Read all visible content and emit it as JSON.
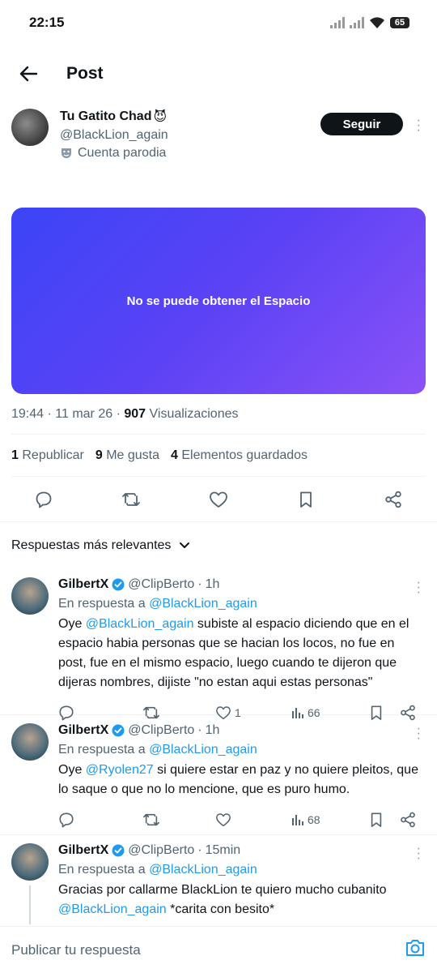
{
  "status_bar": {
    "time": "22:15",
    "battery": "65"
  },
  "header": {
    "title": "Post"
  },
  "author": {
    "name": "Tu Gatito Chad",
    "emoji": "😈",
    "handle": "@BlackLion_again",
    "badge_label": "Cuenta parodia",
    "follow_label": "Seguir"
  },
  "space_card": {
    "message": "No se puede obtener el Espacio"
  },
  "meta": {
    "time": "19:44",
    "date": "11 mar 26",
    "views_count": "907",
    "views_label": "Visualizaciones"
  },
  "stats": {
    "reposts_count": "1",
    "reposts_label": "Republicar",
    "likes_count": "9",
    "likes_label": "Me gusta",
    "bookmarks_count": "4",
    "bookmarks_label": "Elementos guardados"
  },
  "sort": {
    "label": "Respuestas más relevantes"
  },
  "replies": [
    {
      "name": "GilbertX",
      "handle": "@ClipBerto",
      "time": "1h",
      "replying_prefix": "En respuesta a",
      "replying_to": "@BlackLion_again",
      "text_prefix": "Oye",
      "mention": "@BlackLion_again",
      "text_rest": "subiste al espacio diciendo que en el espacio habia personas que se hacian los locos, no fue en post, fue en el mismo espacio, luego cuando te dijeron que dijeras nombres, dijiste \"no estan aqui estas personas\"",
      "likes": "1",
      "views": "66"
    },
    {
      "name": "GilbertX",
      "handle": "@ClipBerto",
      "time": "1h",
      "replying_prefix": "En respuesta a",
      "replying_to": "@BlackLion_again",
      "text_prefix": "Oye",
      "mention": "@Ryolen27",
      "text_rest": "si quiere estar en paz y no quiere pleitos, que lo saque o que no lo mencione, que es puro humo.",
      "likes": "",
      "views": "68"
    },
    {
      "name": "GilbertX",
      "handle": "@ClipBerto",
      "time": "15min",
      "replying_prefix": "En respuesta a",
      "replying_to": "@BlackLion_again",
      "text_prefix": "Gracias por callarme BlackLion te quiero mucho cubanito",
      "mention": "@BlackLion_again",
      "text_rest": "*carita con besito*"
    }
  ],
  "compose": {
    "placeholder": "Publicar tu respuesta"
  },
  "colors": {
    "accent": "#1d9bf0",
    "space_gradient_start": "#3b45f7",
    "space_gradient_end": "#8a52f7",
    "text_secondary": "#536471"
  }
}
